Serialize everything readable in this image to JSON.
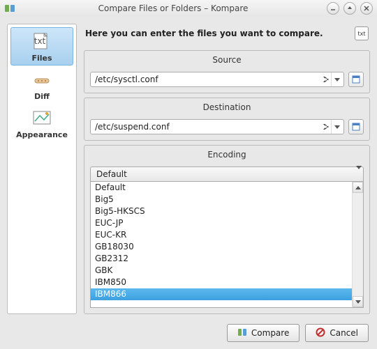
{
  "window": {
    "title": "Compare Files or Folders – Kompare"
  },
  "sidebar": {
    "items": [
      {
        "label": "Files"
      },
      {
        "label": "Diff"
      },
      {
        "label": "Appearance"
      }
    ]
  },
  "header": {
    "text": "Here you can enter the files you want to compare."
  },
  "source": {
    "title": "Source",
    "value": "/etc/sysctl.conf"
  },
  "destination": {
    "title": "Destination",
    "value": "/etc/suspend.conf"
  },
  "encoding": {
    "title": "Encoding",
    "selected": "Default",
    "options": [
      "Default",
      "Big5",
      "Big5-HKSCS",
      "EUC-JP",
      "EUC-KR",
      "GB18030",
      "GB2312",
      "GBK",
      "IBM850",
      "IBM866"
    ],
    "highlighted": "IBM866"
  },
  "buttons": {
    "compare": "Compare",
    "cancel": "Cancel"
  }
}
